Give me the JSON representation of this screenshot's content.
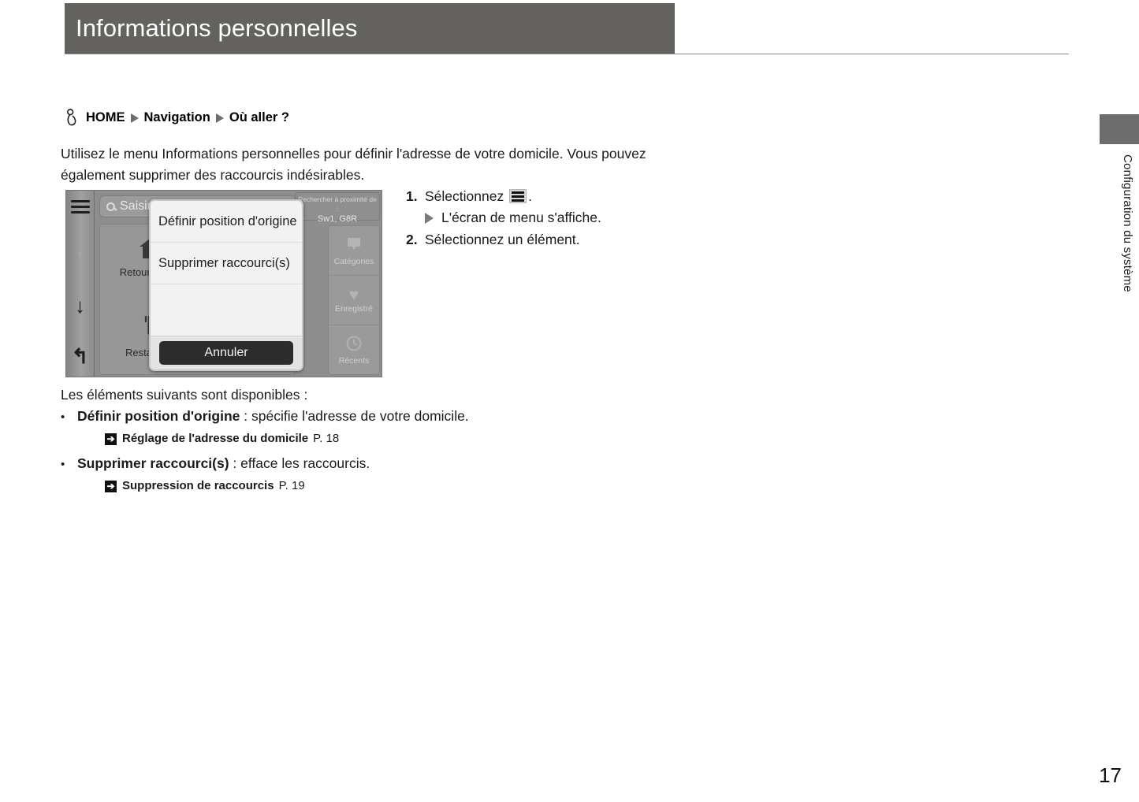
{
  "header": {
    "title": "Informations personnelles"
  },
  "breadcrumb": {
    "icon": "hand-pointer-icon",
    "items": [
      "HOME",
      "Navigation",
      "Où aller ?"
    ]
  },
  "intro": {
    "paragraph": "Utilisez le menu Informations personnelles pour définir l'adresse de votre domicile. Vous pouvez également supprimer des raccourcis indésirables."
  },
  "steps": [
    {
      "number": "1.",
      "text_before": "Sélectionnez",
      "icon": "hamburger-menu-icon",
      "text_after": ".",
      "substep": "L'écran de menu s'affiche."
    },
    {
      "number": "2.",
      "text_before": "Sélectionnez un élément.",
      "icon": "",
      "text_after": "",
      "substep": ""
    }
  ],
  "screenshot": {
    "search_placeholder": "Saisir",
    "nearby_label": "Rechercher à proximité de :",
    "nearby_value": "Sw1, G8R",
    "rail": [
      {
        "name": "menu-icon",
        "glyph": ""
      },
      {
        "name": "arrow-up-icon",
        "glyph": "↑"
      },
      {
        "name": "arrow-down-icon",
        "glyph": "↓"
      },
      {
        "name": "back-arrow-icon",
        "glyph": "↰"
      }
    ],
    "tiles": [
      {
        "icon": "house-icon",
        "glyph": "⌂",
        "label": "Retour maison"
      },
      {
        "icon": "restaurant-icon",
        "glyph": "🍴",
        "label": "Restaurants"
      }
    ],
    "side_buttons": [
      {
        "icon": "map-pin-icon",
        "glyph": "⬟",
        "label": "Catégories"
      },
      {
        "icon": "heart-icon",
        "glyph": "♥",
        "label": "Enregistré"
      },
      {
        "icon": "clock-icon",
        "glyph": "◴",
        "label": "Récents"
      }
    ],
    "dialog": {
      "items": [
        "Définir position d'origine",
        "Supprimer raccourci(s)"
      ],
      "cancel_label": "Annuler"
    }
  },
  "available": {
    "lead": "Les éléments suivants sont disponibles :",
    "items": [
      {
        "bullet": "•",
        "term": "Définir position d'origine",
        "desc": " : spécifie l'adresse de votre domicile.",
        "xref_title": "Réglage de l'adresse du domicile",
        "xref_page": "P. 18"
      },
      {
        "bullet": "•",
        "term": "Supprimer raccourci(s)",
        "desc": " : efface les raccourcis.",
        "xref_title": "Suppression de raccourcis",
        "xref_page": "P. 19"
      }
    ]
  },
  "side_tab": {
    "label": "Configuration du système",
    "color": "#6d6d6d"
  },
  "footer": {
    "page_number": "17"
  }
}
